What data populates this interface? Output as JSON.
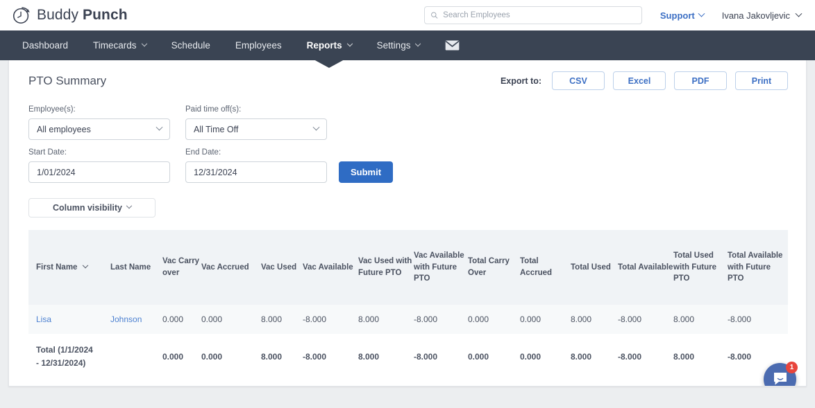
{
  "brand": {
    "name_light": "Buddy",
    "name_bold": "Punch",
    "logo_icon": "clock-icon"
  },
  "topbar": {
    "search": {
      "placeholder": "Search Employees",
      "value": "",
      "icon": "search-icon"
    },
    "support": {
      "label": "Support",
      "icon": "chevron-down-icon",
      "color": "#3c6fc4"
    },
    "user": {
      "label": "Ivana Jakovljevic",
      "icon": "chevron-down-icon"
    }
  },
  "nav": {
    "background": "#3a4453",
    "items": [
      {
        "label": "Dashboard",
        "has_chevron": false,
        "active": false
      },
      {
        "label": "Timecards",
        "has_chevron": true,
        "active": false
      },
      {
        "label": "Schedule",
        "has_chevron": false,
        "active": false
      },
      {
        "label": "Employees",
        "has_chevron": false,
        "active": false
      },
      {
        "label": "Reports",
        "has_chevron": true,
        "active": true
      },
      {
        "label": "Settings",
        "has_chevron": true,
        "active": false
      }
    ],
    "mail_icon": "envelope-icon"
  },
  "card": {
    "title": "PTO Summary",
    "export": {
      "label": "Export to:",
      "buttons": [
        "CSV",
        "Excel",
        "PDF",
        "Print"
      ]
    }
  },
  "filters": {
    "employee": {
      "label": "Employee(s):",
      "value": "All employees"
    },
    "pto": {
      "label": "Paid time off(s):",
      "value": "All Time Off"
    },
    "start": {
      "label": "Start Date:",
      "value": "1/01/2024"
    },
    "end": {
      "label": "End Date:",
      "value": "12/31/2024"
    },
    "submit_label": "Submit",
    "column_visibility_label": "Column visibility"
  },
  "table": {
    "headers": [
      "First Name",
      "Last Name",
      "Vac Carry over",
      "Vac Accrued",
      "Vac Used",
      "Vac Available",
      "Vac Used with Future PTO",
      "Vac Available with Future PTO",
      "Total Carry Over",
      "Total Accrued",
      "Total Used",
      "Total Available",
      "Total Used with Future PTO",
      "Total Available with Future PTO"
    ],
    "rows": [
      {
        "first_name": "Lisa",
        "last_name": "Johnson",
        "values": [
          "0.000",
          "0.000",
          "8.000",
          "-8.000",
          "8.000",
          "-8.000",
          "0.000",
          "0.000",
          "8.000",
          "-8.000",
          "8.000",
          "-8.000"
        ]
      }
    ],
    "total": {
      "label_line1": "Total (1/1/2024",
      "label_line2": "- 12/31/2024)",
      "values": [
        "0.000",
        "0.000",
        "8.000",
        "-8.000",
        "8.000",
        "-8.000",
        "0.000",
        "0.000",
        "8.000",
        "-8.000",
        "8.000",
        "-8.000"
      ]
    }
  },
  "chat": {
    "icon": "chat-bubble-icon",
    "badge": "1",
    "color": "#4b6bb0",
    "badge_color": "#e8453c"
  }
}
